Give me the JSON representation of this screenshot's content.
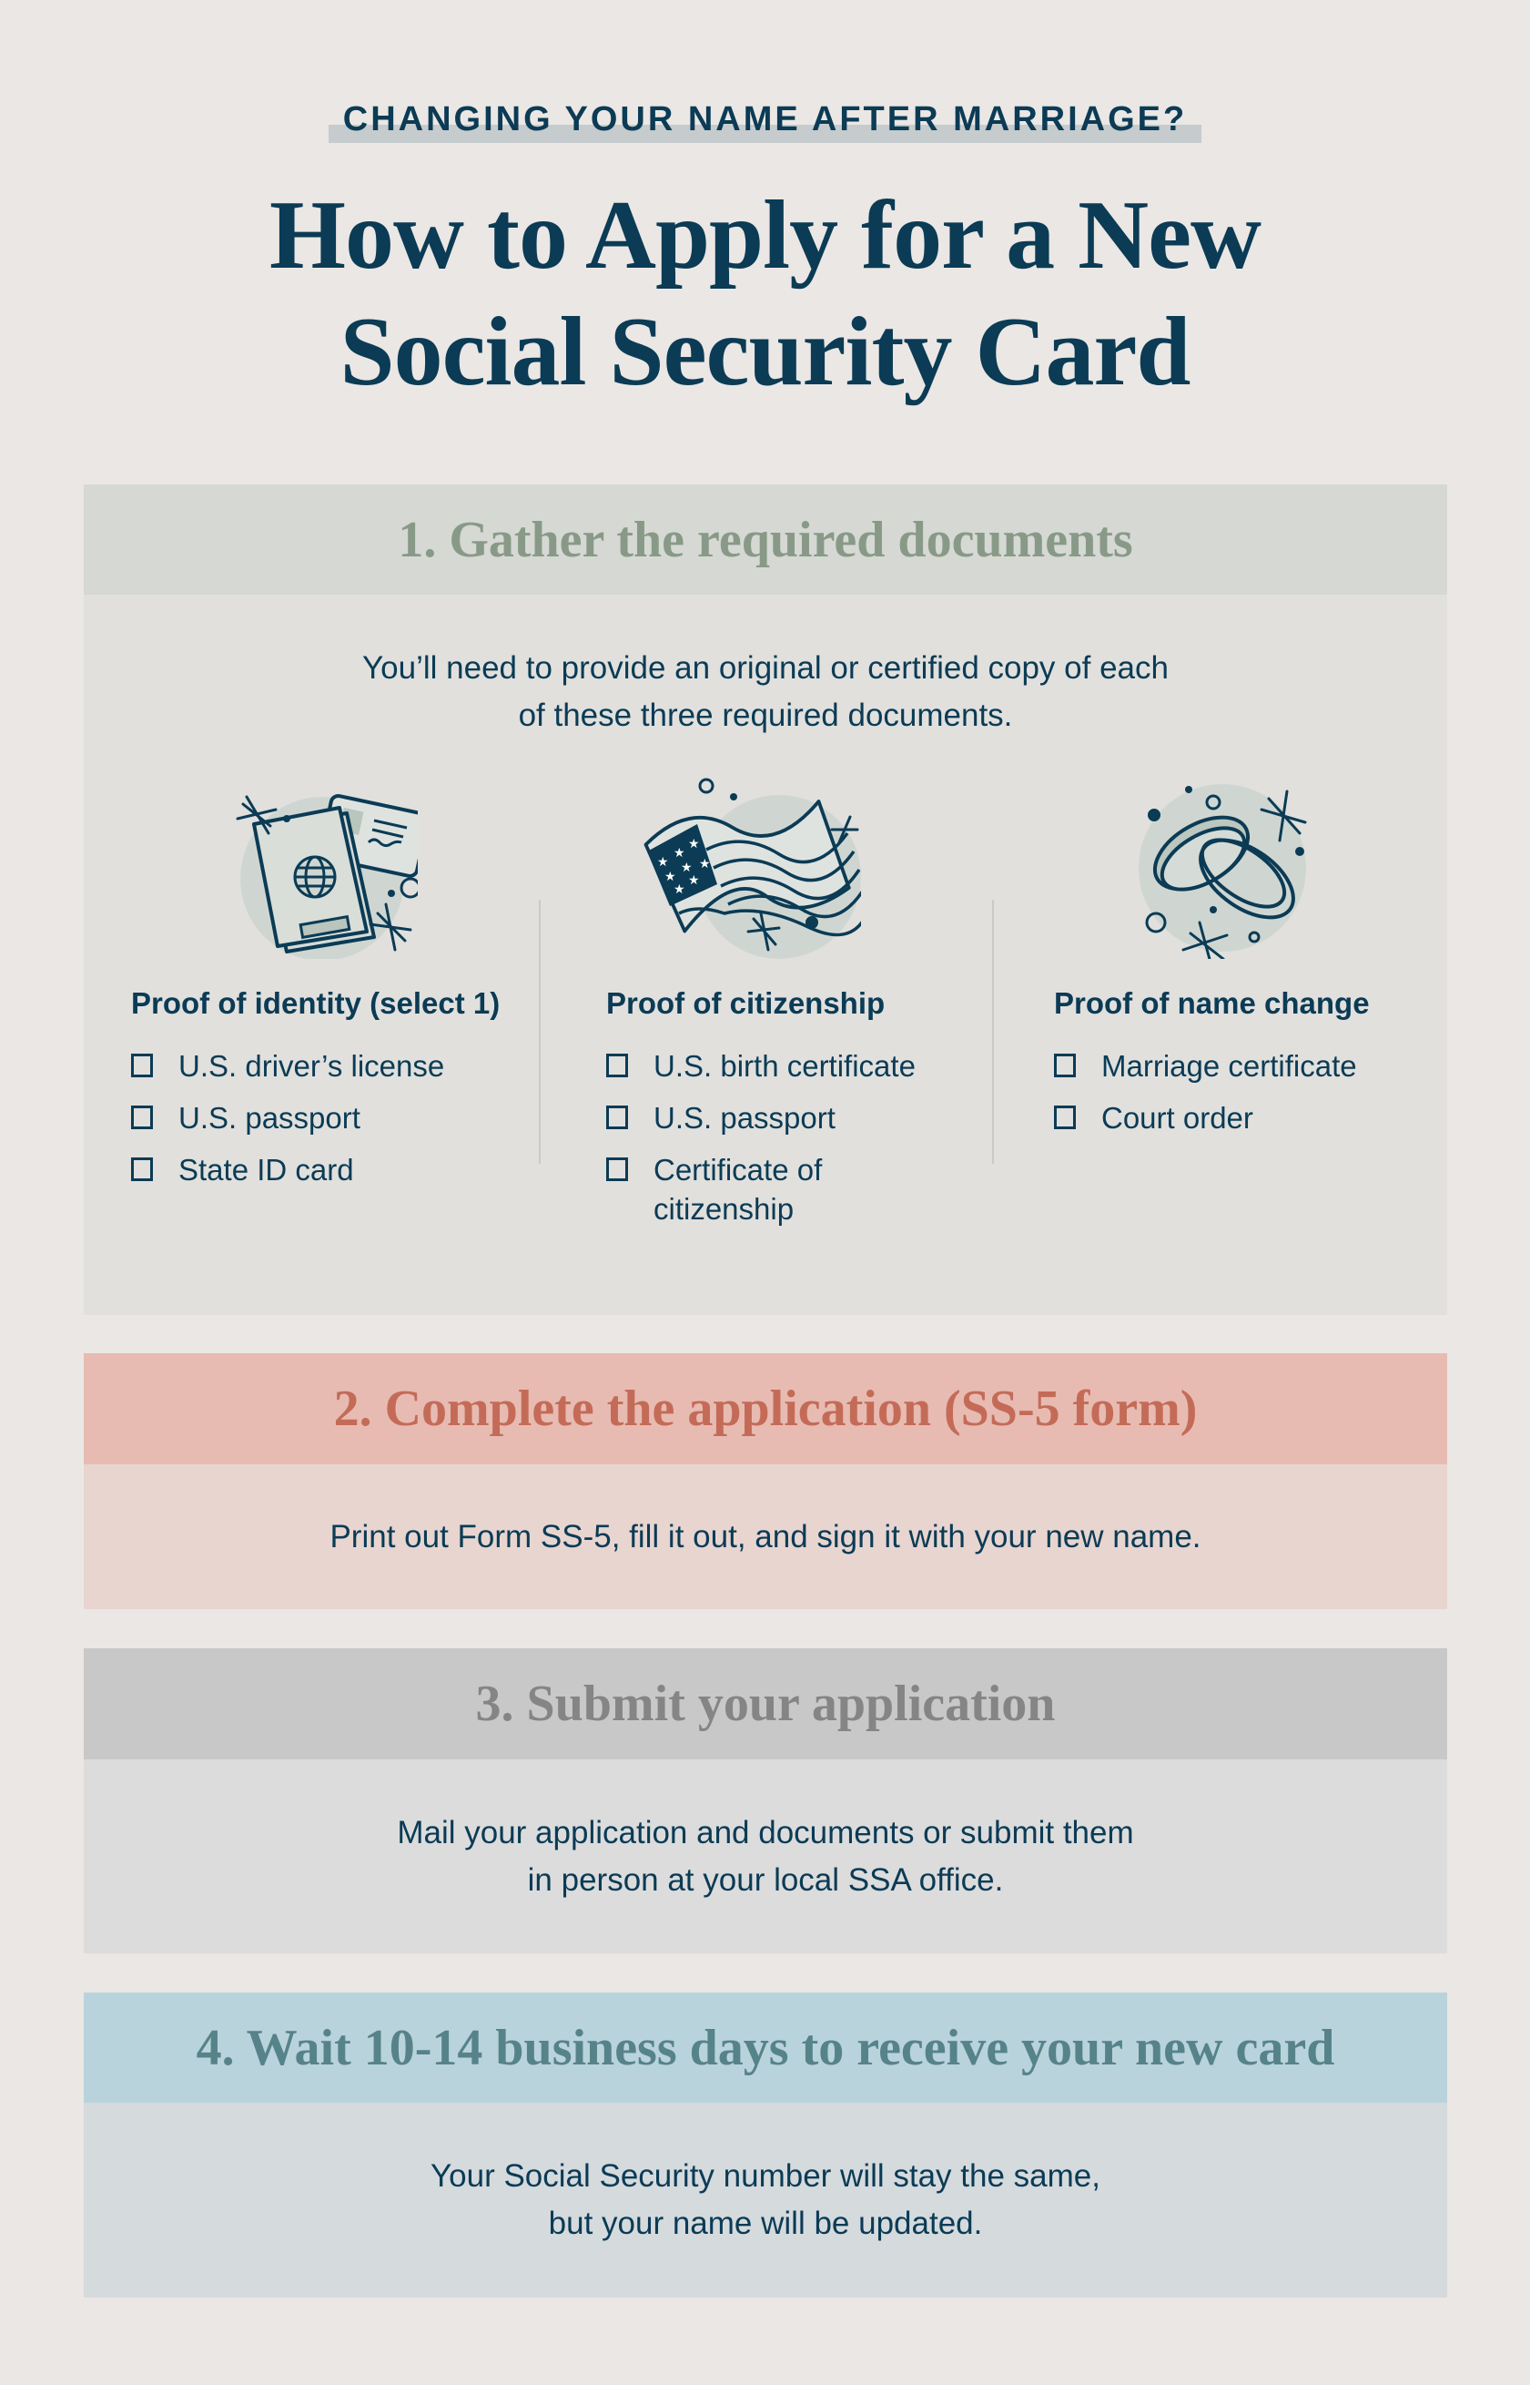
{
  "header": {
    "kicker": "CHANGING YOUR NAME AFTER MARRIAGE?",
    "title_line1": "How to Apply for a New",
    "title_line2": "Social Security Card"
  },
  "colors": {
    "navy": "#0b3b55",
    "background": "#ebe7e4",
    "step1_accent": "#889a87",
    "step2_accent": "#c46b58",
    "step3_accent": "#858585",
    "step4_accent": "#568389"
  },
  "steps": [
    {
      "title": "1. Gather the required documents",
      "intro_line1": "You’ll need to provide an original or certified copy of each",
      "intro_line2": "of these three required documents.",
      "columns": [
        {
          "icon": "passport-id-card-icon",
          "title": "Proof of identity (select 1)",
          "items": [
            {
              "label": "U.S. driver’s license",
              "checked": false
            },
            {
              "label": "U.S. passport",
              "checked": false
            },
            {
              "label": "State ID card",
              "checked": false
            }
          ]
        },
        {
          "icon": "us-flag-icon",
          "title": "Proof of citizenship",
          "items": [
            {
              "label": "U.S. birth certificate",
              "checked": false
            },
            {
              "label": "U.S. passport",
              "checked": false
            },
            {
              "label": "Certificate of citizenship",
              "checked": false
            }
          ]
        },
        {
          "icon": "wedding-rings-icon",
          "title": "Proof of name change",
          "items": [
            {
              "label": "Marriage certificate",
              "checked": false
            },
            {
              "label": "Court order",
              "checked": false
            }
          ]
        }
      ]
    },
    {
      "title": "2. Complete the application (SS-5 form)",
      "body_line1": "Print out Form SS-5, fill it out, and sign it with your new name."
    },
    {
      "title": "3. Submit your application",
      "body_line1": "Mail your application and documents or submit them",
      "body_line2": "in person at your local SSA office."
    },
    {
      "title": "4. Wait 10-14 business days to receive your new card",
      "body_line1": "Your Social Security number will stay the same,",
      "body_line2": "but your name will be updated."
    }
  ]
}
